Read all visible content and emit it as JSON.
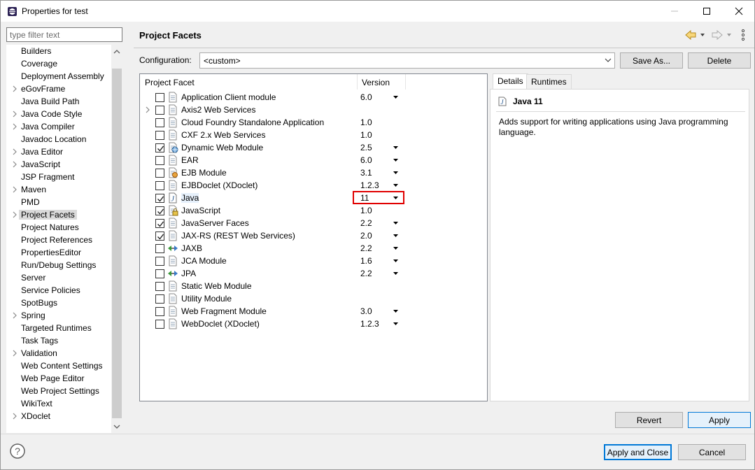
{
  "window": {
    "title": "Properties for test"
  },
  "filter": {
    "placeholder": "type filter text"
  },
  "tree": {
    "items": [
      {
        "label": "Builders",
        "arrow": false
      },
      {
        "label": "Coverage",
        "arrow": false
      },
      {
        "label": "Deployment Assembly",
        "arrow": false
      },
      {
        "label": "eGovFrame",
        "arrow": true
      },
      {
        "label": "Java Build Path",
        "arrow": false
      },
      {
        "label": "Java Code Style",
        "arrow": true
      },
      {
        "label": "Java Compiler",
        "arrow": true
      },
      {
        "label": "Javadoc Location",
        "arrow": false
      },
      {
        "label": "Java Editor",
        "arrow": true
      },
      {
        "label": "JavaScript",
        "arrow": true
      },
      {
        "label": "JSP Fragment",
        "arrow": false
      },
      {
        "label": "Maven",
        "arrow": true
      },
      {
        "label": "PMD",
        "arrow": false
      },
      {
        "label": "Project Facets",
        "arrow": true,
        "selected": true
      },
      {
        "label": "Project Natures",
        "arrow": false
      },
      {
        "label": "Project References",
        "arrow": false
      },
      {
        "label": "PropertiesEditor",
        "arrow": false
      },
      {
        "label": "Run/Debug Settings",
        "arrow": false
      },
      {
        "label": "Server",
        "arrow": false
      },
      {
        "label": "Service Policies",
        "arrow": false
      },
      {
        "label": "SpotBugs",
        "arrow": false
      },
      {
        "label": "Spring",
        "arrow": true
      },
      {
        "label": "Targeted Runtimes",
        "arrow": false
      },
      {
        "label": "Task Tags",
        "arrow": false
      },
      {
        "label": "Validation",
        "arrow": true
      },
      {
        "label": "Web Content Settings",
        "arrow": false
      },
      {
        "label": "Web Page Editor",
        "arrow": false
      },
      {
        "label": "Web Project Settings",
        "arrow": false
      },
      {
        "label": "WikiText",
        "arrow": false
      },
      {
        "label": "XDoclet",
        "arrow": true
      }
    ]
  },
  "page": {
    "title": "Project Facets"
  },
  "config": {
    "label": "Configuration:",
    "value": "<custom>",
    "save_as": "Save As...",
    "delete": "Delete"
  },
  "facets": {
    "col_facet": "Project Facet",
    "col_version": "Version",
    "rows": [
      {
        "name": "Application Client module",
        "version": "6.0",
        "checked": false,
        "dropdown": true,
        "icon": "doc-icon",
        "expand": false
      },
      {
        "name": "Axis2 Web Services",
        "version": "",
        "checked": false,
        "dropdown": false,
        "icon": "doc-icon",
        "expand": true
      },
      {
        "name": "Cloud Foundry Standalone Application",
        "version": "1.0",
        "checked": false,
        "dropdown": false,
        "icon": "doc-icon",
        "expand": false
      },
      {
        "name": "CXF 2.x Web Services",
        "version": "1.0",
        "checked": false,
        "dropdown": false,
        "icon": "doc-icon",
        "expand": false
      },
      {
        "name": "Dynamic Web Module",
        "version": "2.5",
        "checked": true,
        "dropdown": true,
        "icon": "globe-doc-icon",
        "expand": false
      },
      {
        "name": "EAR",
        "version": "6.0",
        "checked": false,
        "dropdown": true,
        "icon": "doc-icon",
        "expand": false
      },
      {
        "name": "EJB Module",
        "version": "3.1",
        "checked": false,
        "dropdown": true,
        "icon": "bean-doc-icon",
        "expand": false
      },
      {
        "name": "EJBDoclet (XDoclet)",
        "version": "1.2.3",
        "checked": false,
        "dropdown": true,
        "icon": "doc-icon",
        "expand": false
      },
      {
        "name": "Java",
        "version": "11",
        "checked": true,
        "dropdown": true,
        "icon": "java-icon",
        "expand": false,
        "highlight": true
      },
      {
        "name": "JavaScript",
        "version": "1.0",
        "checked": true,
        "dropdown": false,
        "icon": "lock-doc-icon",
        "expand": false
      },
      {
        "name": "JavaServer Faces",
        "version": "2.2",
        "checked": true,
        "dropdown": true,
        "icon": "doc-icon",
        "expand": false
      },
      {
        "name": "JAX-RS (REST Web Services)",
        "version": "2.0",
        "checked": true,
        "dropdown": true,
        "icon": "doc-icon",
        "expand": false
      },
      {
        "name": "JAXB",
        "version": "2.2",
        "checked": false,
        "dropdown": true,
        "icon": "arrows-icon",
        "expand": false
      },
      {
        "name": "JCA Module",
        "version": "1.6",
        "checked": false,
        "dropdown": true,
        "icon": "doc-icon",
        "expand": false
      },
      {
        "name": "JPA",
        "version": "2.2",
        "checked": false,
        "dropdown": true,
        "icon": "arrows-icon",
        "expand": false
      },
      {
        "name": "Static Web Module",
        "version": "",
        "checked": false,
        "dropdown": false,
        "icon": "doc-icon",
        "expand": false
      },
      {
        "name": "Utility Module",
        "version": "",
        "checked": false,
        "dropdown": false,
        "icon": "doc-icon",
        "expand": false
      },
      {
        "name": "Web Fragment Module",
        "version": "3.0",
        "checked": false,
        "dropdown": true,
        "icon": "doc-icon",
        "expand": false
      },
      {
        "name": "WebDoclet (XDoclet)",
        "version": "1.2.3",
        "checked": false,
        "dropdown": true,
        "icon": "doc-icon",
        "expand": false
      }
    ]
  },
  "details": {
    "tabs": [
      "Details",
      "Runtimes"
    ],
    "title": "Java 11",
    "description": "Adds support for writing applications using Java programming language."
  },
  "buttons": {
    "revert": "Revert",
    "apply": "Apply",
    "apply_close": "Apply and Close",
    "cancel": "Cancel"
  },
  "colors": {
    "highlight_box": "#e00000",
    "default_button": "#0078d7"
  }
}
